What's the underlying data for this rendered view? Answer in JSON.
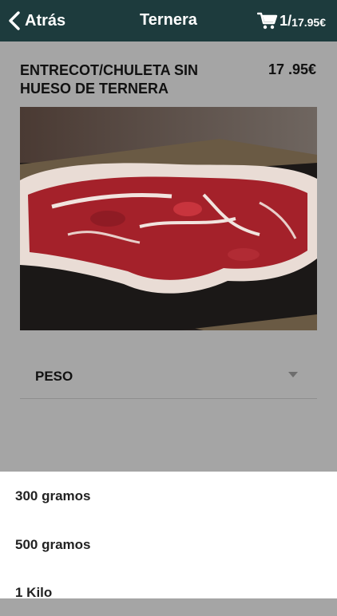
{
  "header": {
    "back_label": "Atrás",
    "title": "Ternera",
    "cart_count": "1",
    "cart_separator": "/",
    "cart_total": "17.95€"
  },
  "product": {
    "name": "ENTRECOT/CHULETA SIN HUESO DE TERNERA",
    "price": "17 .95€",
    "image_icon": "beef-steak-photo"
  },
  "weight_select": {
    "label": "PESO"
  },
  "options": [
    {
      "label": "300 gramos"
    },
    {
      "label": "500 gramos"
    },
    {
      "label": "1 Kilo"
    }
  ],
  "colors": {
    "header_bg": "#1d3b3d",
    "overlay": "#a5a5a5",
    "sheet_bg": "#ffffff"
  }
}
